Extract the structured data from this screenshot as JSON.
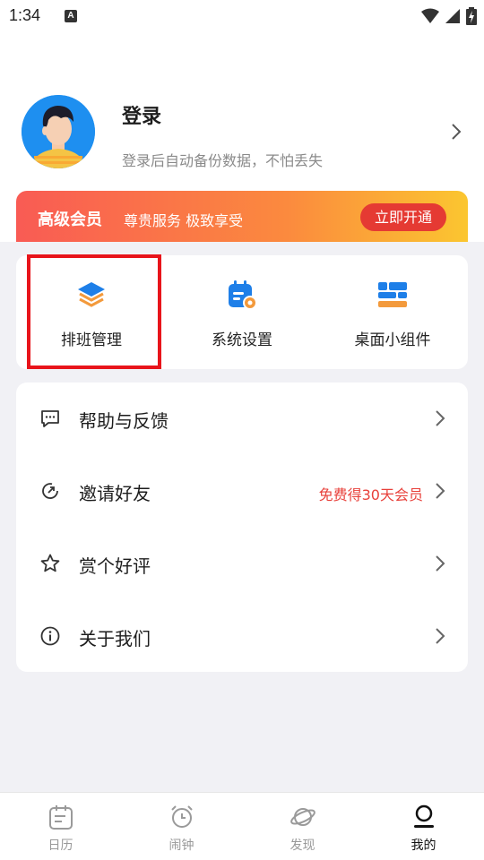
{
  "status_bar": {
    "time": "1:34",
    "notification_badge": "A"
  },
  "profile": {
    "login_label": "登录",
    "subtitle": "登录后自动备份数据，不怕丢失"
  },
  "vip": {
    "title": "高级会员",
    "slogan": "尊贵服务 极致享受",
    "button_label": "立即开通",
    "gradient_start": "#f95b54",
    "gradient_end": "#fbc630"
  },
  "tools": [
    {
      "label": "排班管理",
      "icon": "layers-icon"
    },
    {
      "label": "系统设置",
      "icon": "calendar-gear-icon"
    },
    {
      "label": "桌面小组件",
      "icon": "widget-icon"
    }
  ],
  "menu": [
    {
      "label": "帮助与反馈",
      "icon": "feedback-icon",
      "extra": ""
    },
    {
      "label": "邀请好友",
      "icon": "invite-icon",
      "extra": "免费得30天会员"
    },
    {
      "label": "赏个好评",
      "icon": "star-icon",
      "extra": ""
    },
    {
      "label": "关于我们",
      "icon": "info-icon",
      "extra": ""
    }
  ],
  "tabs": [
    {
      "label": "日历",
      "icon": "calendar-icon",
      "active": false
    },
    {
      "label": "闹钟",
      "icon": "alarm-icon",
      "active": false
    },
    {
      "label": "发现",
      "icon": "planet-icon",
      "active": false
    },
    {
      "label": "我的",
      "icon": "user-icon",
      "active": true
    }
  ],
  "colors": {
    "accent_blue": "#1e8ff0",
    "accent_orange": "#f39a3c",
    "highlight_red": "#e8141b",
    "promo_red": "#e8413b"
  }
}
